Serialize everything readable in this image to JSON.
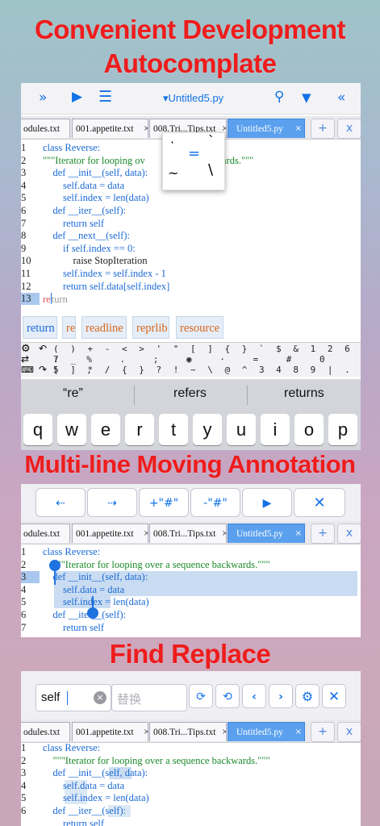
{
  "headlines": {
    "autocomplete_line1": "Convenient Development",
    "autocomplete_line2": "Autocomplate",
    "multiline": "Multi-line Moving  Annotation",
    "find_replace": "Find Replace"
  },
  "editor": {
    "file_title": "▾Untitled5.py",
    "toolbar_icons": [
      "indent-right-icon",
      "play-icon",
      "list-icon",
      "search-icon",
      "arrow-down-icon",
      "indent-left-icon"
    ],
    "tabs": [
      {
        "label": "odules.txt",
        "close": "×"
      },
      {
        "label": "001.appetite.txt",
        "close": "×"
      },
      {
        "label": "008.Tri...Tips.txt",
        "close": "×"
      },
      {
        "label": "Untitled5.py",
        "close": "×",
        "active": true
      }
    ],
    "add_tab": "+",
    "close_tab": "x"
  },
  "code_lines": [
    "class Reverse:",
    "    \"\"\"Iterator for looping over a sequence backwards.\"\"\"",
    "    def __init__(self, data):",
    "        self.data = data",
    "        self.index = len(data)",
    "    def __iter__(self):",
    "        return self",
    "    def __next__(self):",
    "        if self.index == 0:",
    "            raise StopIteration",
    "        self.index = self.index - 1",
    "        return self.data[self.index]",
    "        return"
  ],
  "line_numbers": [
    "1",
    "2",
    "3",
    "4",
    "5",
    "6",
    "7",
    "8",
    "9",
    "10",
    "11",
    "12",
    "13"
  ],
  "panel1_code": {
    "l2_visible": "\"\"\"Iterator for looping ov",
    "l2_tail": "e backwards.\"\"\"",
    "l13_typed": "re",
    "l13_ghost": "turn"
  },
  "popup_symbols": [
    "·",
    "`",
    "=",
    "~",
    "\\"
  ],
  "autocomplete": [
    "return",
    "re",
    "readline",
    "reprlib",
    "resource"
  ],
  "symbol_rows": {
    "row1": "( ) + - < > ' \" [ ] { } ` $ & 1 2 6 7 _",
    "row2": ": % . ; ◉ · = # 0 5 ,",
    "row3": "[ ] * / { } ? ! ~ \\ @ ^ 3 4 8 9 | ."
  },
  "keyboard": {
    "suggestions": [
      "“re”",
      "refers",
      "returns"
    ],
    "keys": [
      "q",
      "w",
      "e",
      "r",
      "t",
      "y",
      "u",
      "i",
      "o",
      "p"
    ]
  },
  "multiline_toolbar": {
    "buttons": [
      "⇠",
      "⇢",
      "+\"#\"",
      "-\"#\"",
      "▶",
      "✕"
    ]
  },
  "find_replace": {
    "search_value": "self",
    "replace_placeholder": "替换",
    "buttons": [
      "replace-one-icon",
      "replace-all-icon",
      "chevron-left-icon",
      "chevron-right-icon",
      "gear-icon",
      "close-icon"
    ]
  },
  "colors": {
    "headline": "#ee1c1c",
    "accent": "#1272e6",
    "active_tab": "#5aa0ee",
    "keyword": "#1b6ad6",
    "string": "#1a8a2a",
    "number": "#e05252",
    "suggestion_text": "#d9651a"
  }
}
